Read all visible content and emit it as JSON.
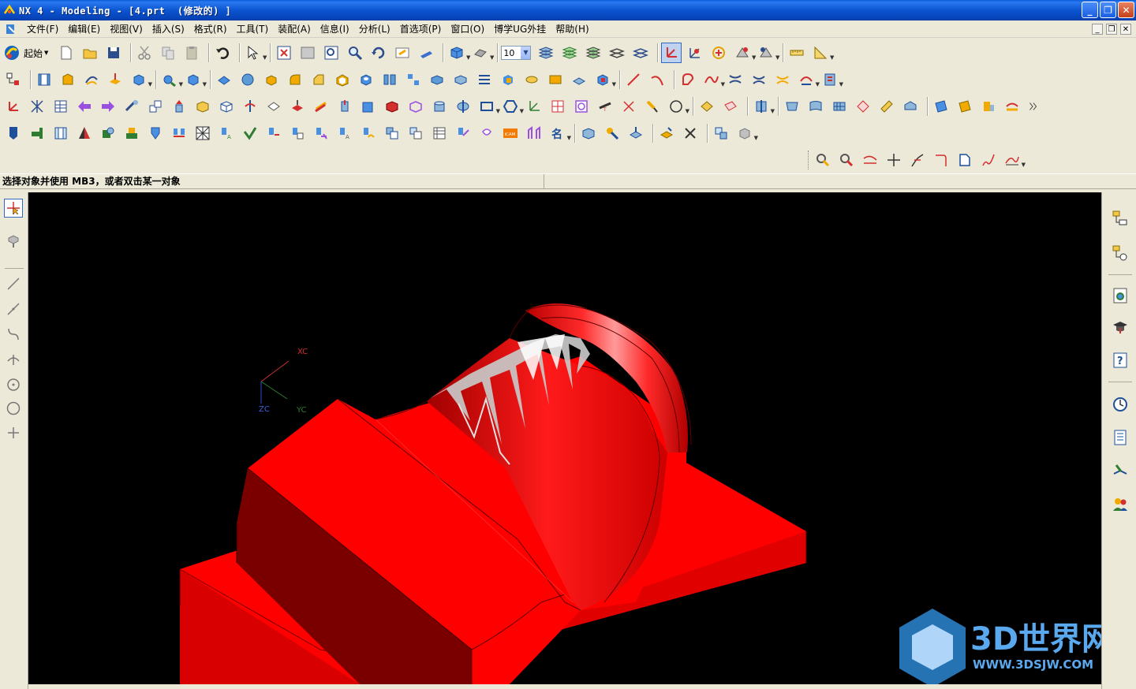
{
  "window": {
    "title": "NX 4 - Modeling - [4.prt  (修改的) ]",
    "minimize": "_",
    "restore": "❐",
    "close": "✕"
  },
  "menu": {
    "items": [
      "文件(F)",
      "编辑(E)",
      "视图(V)",
      "插入(S)",
      "格式(R)",
      "工具(T)",
      "装配(A)",
      "信息(I)",
      "分析(L)",
      "首选项(P)",
      "窗口(O)",
      "博学UG外挂",
      "帮助(H)"
    ],
    "doc_min": "_",
    "doc_restore": "❐",
    "doc_close": "✕"
  },
  "toolbar": {
    "start_label": "起始",
    "font_size_value": "10",
    "dropdown_arrow": "▼"
  },
  "status": {
    "cue": "选择对象并使用 MB3，或者双击某一对象"
  },
  "viewport": {
    "background": "#000000",
    "model_color": "#ff0000",
    "triad": {
      "x_label": "XC",
      "y_label": "YC",
      "z_label": "ZC"
    },
    "watermark_title": "3D世界网",
    "watermark_url": "WWW.3DSJW.COM"
  },
  "icons": {
    "row1": [
      "start-icon",
      "new-icon",
      "open-icon",
      "save-icon",
      "cut-icon",
      "copy-icon",
      "paste-icon",
      "undo-icon",
      "select-icon",
      "fit-icon",
      "zoom-window-icon",
      "zoom-icon",
      "pan-icon",
      "rotate-icon",
      "perspective-icon",
      "view-cube-icon",
      "shaded-icon",
      "layer-settings-icon",
      "layer-move-icon",
      "layer-copy-icon",
      "wcs-icon",
      "wcs-origin-icon",
      "wcs-rotate-icon",
      "wcs-orient-icon",
      "measure-icon",
      "drafting-icon"
    ],
    "left": [
      "select-cursor-icon",
      "snap-icon",
      "line-icon",
      "line2-icon",
      "spline-icon",
      "point-icon",
      "circle-icon",
      "arc-icon",
      "crosshair-icon"
    ],
    "right": [
      "assembly-navigator-icon",
      "part-navigator-icon",
      "browser-icon",
      "training-icon",
      "help-icon",
      "history-icon",
      "process-studio-icon",
      "reuse-library-icon",
      "roles-icon"
    ]
  }
}
